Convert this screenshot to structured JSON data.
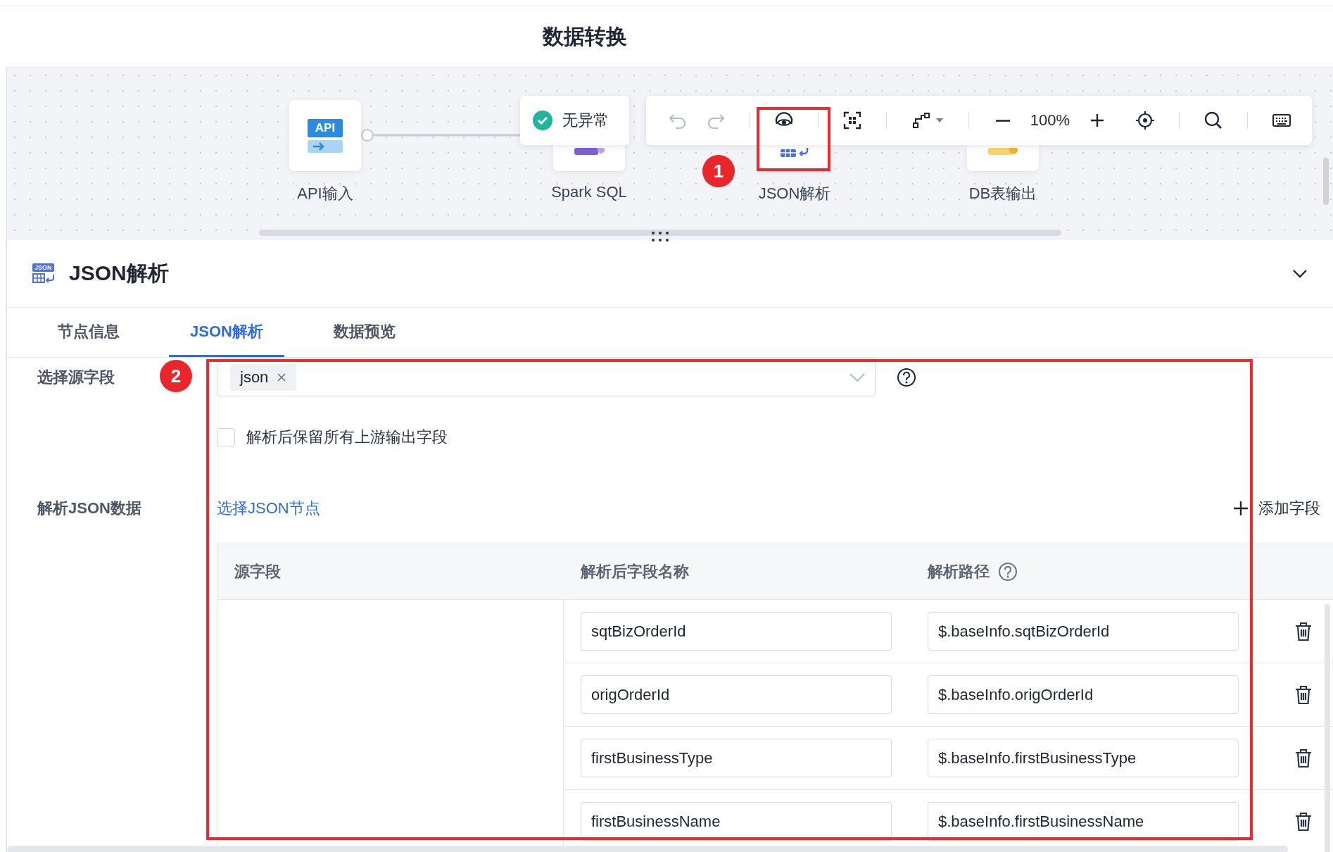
{
  "header": {
    "title": "数据转换"
  },
  "canvas": {
    "nodes": [
      {
        "kind": "api",
        "label": "API输入",
        "icon_text": "API"
      },
      {
        "kind": "sql",
        "label": "Spark SQL"
      },
      {
        "kind": "json",
        "label": "JSON解析"
      },
      {
        "kind": "db",
        "label": "DB表输出"
      }
    ],
    "status": {
      "ok": true,
      "text": "无异常"
    },
    "toolbar": {
      "undo_disabled": true,
      "redo_disabled": true,
      "zoom": "100%"
    }
  },
  "annotations": [
    "1",
    "2"
  ],
  "panel": {
    "icon_text": "JSON",
    "title": "JSON解析",
    "expanded": true,
    "tabs": [
      {
        "label": "节点信息",
        "selected": false
      },
      {
        "label": "JSON解析",
        "selected": true
      },
      {
        "label": "数据预览",
        "selected": false
      }
    ],
    "form": {
      "source_label": "选择源字段",
      "source_tags": [
        "json"
      ],
      "keep_fields": {
        "label": "解析后保留所有上游输出字段",
        "checked": false
      },
      "parse_label": "解析JSON数据",
      "select_node_link": "选择JSON节点",
      "add_field": "添加字段"
    },
    "table": {
      "columns": [
        "源字段",
        "解析后字段名称",
        "解析路径"
      ],
      "rows": [
        {
          "name": "sqtBizOrderId",
          "path": "$.baseInfo.sqtBizOrderId"
        },
        {
          "name": "origOrderId",
          "path": "$.baseInfo.origOrderId"
        },
        {
          "name": "firstBusinessType",
          "path": "$.baseInfo.firstBusinessType"
        },
        {
          "name": "firstBusinessName",
          "path": "$.baseInfo.firstBusinessName"
        }
      ]
    }
  }
}
